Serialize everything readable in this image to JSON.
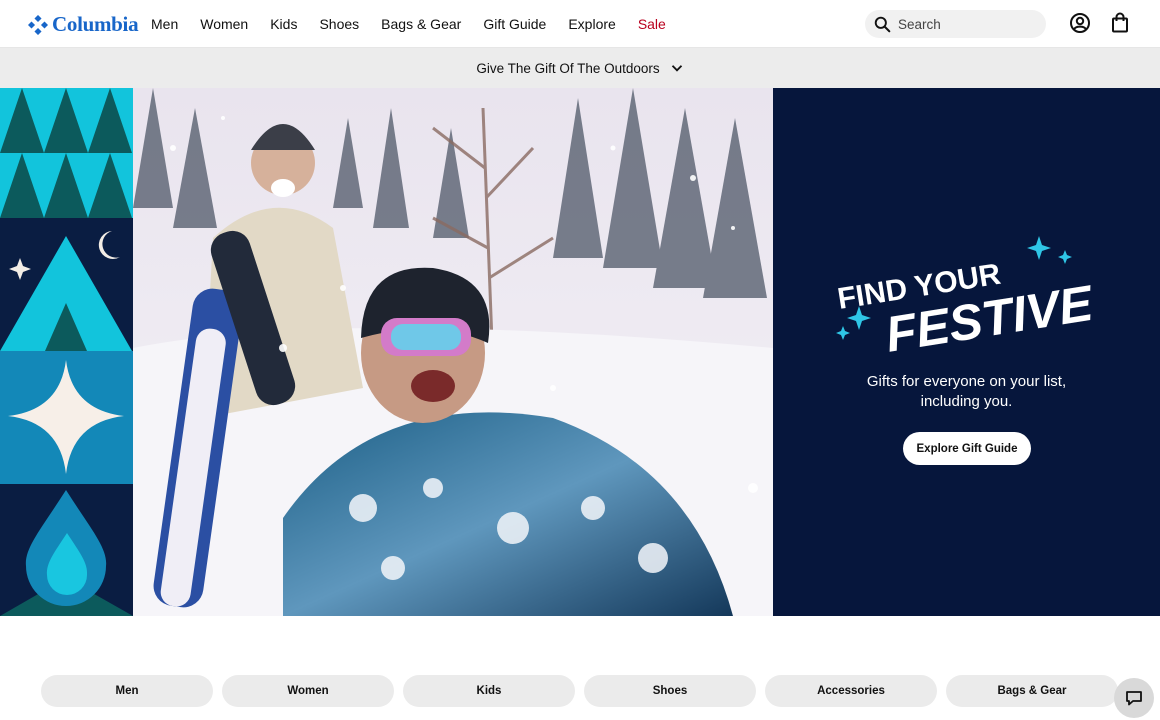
{
  "brand": {
    "name": "Columbia",
    "color": "#1866c9"
  },
  "nav": {
    "items": [
      "Men",
      "Women",
      "Kids",
      "Shoes",
      "Bags & Gear",
      "Gift Guide",
      "Explore"
    ],
    "sale_label": "Sale",
    "sale_color": "#b9001e"
  },
  "search": {
    "placeholder": "Search",
    "icon": "search-icon"
  },
  "header_icons": [
    "account-icon",
    "shopping-bag-icon"
  ],
  "promo_bar": {
    "text": "Give The Gift Of The Outdoors",
    "icon": "chevron-down-icon"
  },
  "hero": {
    "photo_alt": "Two skiers laughing in deep snow",
    "headline_line1": "FIND YOUR",
    "headline_line2": "FESTIVE",
    "body_line1": "Gifts for everyone on your list,",
    "body_line2": "including you.",
    "cta_label": "Explore Gift Guide",
    "panel_color": "#06163c",
    "accent_color": "#2fc6e6"
  },
  "categories": [
    "Men",
    "Women",
    "Kids",
    "Shoes",
    "Accessories",
    "Bags & Gear"
  ],
  "chat": {
    "icon": "chat-icon"
  }
}
